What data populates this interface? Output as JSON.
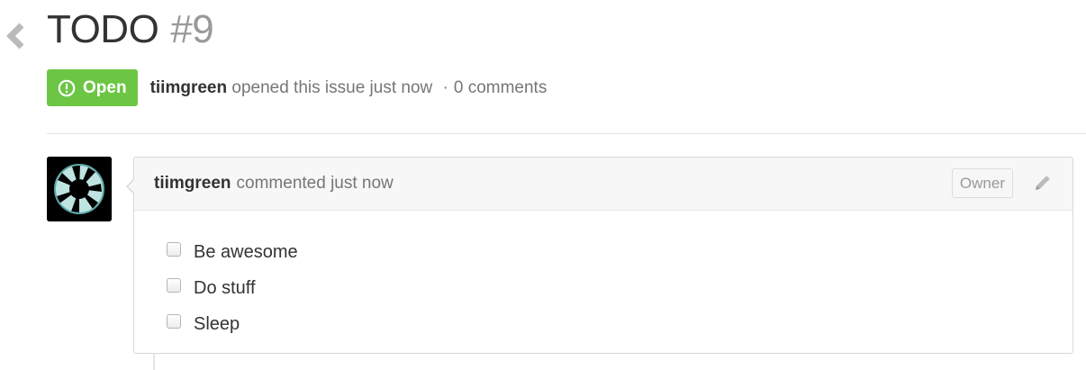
{
  "issue": {
    "title": "TODO",
    "number": "#9",
    "state": "Open",
    "author": "tiimgreen",
    "opened_text": "opened this issue just now",
    "separator": "·",
    "comments_count": "0 comments"
  },
  "comment": {
    "author": "tiimgreen",
    "meta": "commented just now",
    "role_badge": "Owner",
    "tasks": [
      {
        "label": "Be awesome",
        "checked": false
      },
      {
        "label": "Do stuff",
        "checked": false
      },
      {
        "label": "Sleep",
        "checked": false
      }
    ]
  },
  "icons": {
    "back": "chevron-left-icon",
    "state": "issue-opened-icon",
    "edit": "pencil-icon",
    "avatar": "aperture-logo"
  },
  "colors": {
    "open_badge": "#6cc644",
    "muted_text": "#767676",
    "number_text": "#999999"
  }
}
